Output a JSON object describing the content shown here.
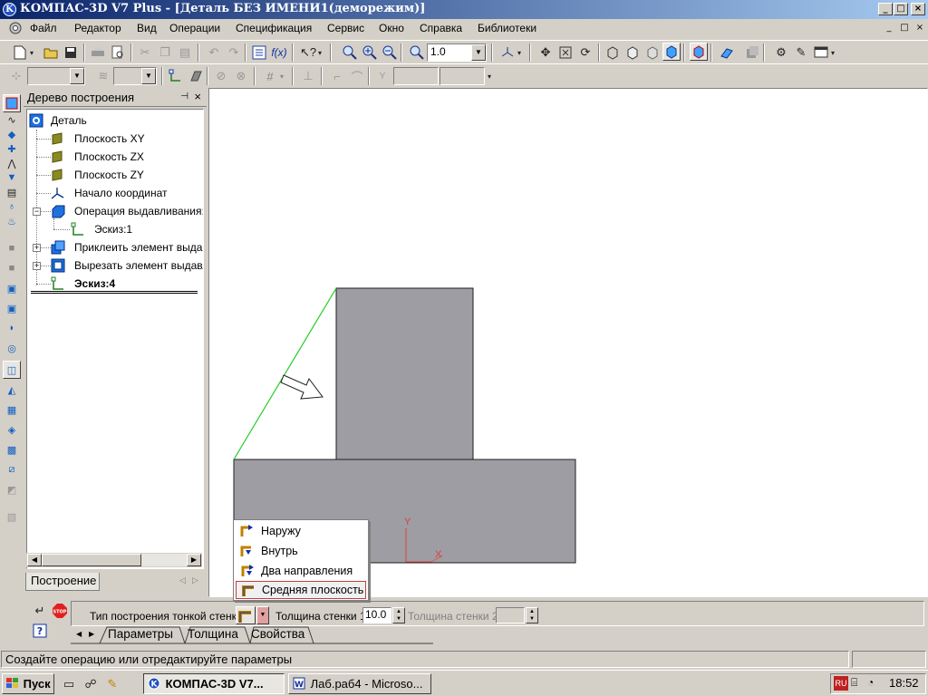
{
  "window": {
    "title": "КОМПАС-3D V7 Plus - [Деталь БЕЗ ИМЕНИ1(деморежим)]",
    "min_glyph": "_",
    "max_glyph": "□",
    "close_glyph": "×"
  },
  "menu": {
    "items": [
      "Файл",
      "Редактор",
      "Вид",
      "Операции",
      "Спецификация",
      "Сервис",
      "Окно",
      "Справка",
      "Библиотеки"
    ]
  },
  "toolbar": {
    "zoom_value": "1.0"
  },
  "tree_panel": {
    "title": "Дерево построения",
    "pin_glyph": "⊣",
    "close_glyph": "×",
    "tab_label": "Построение",
    "items": [
      {
        "label": "Деталь"
      },
      {
        "label": "Плоскость XY"
      },
      {
        "label": "Плоскость ZX"
      },
      {
        "label": "Плоскость ZY"
      },
      {
        "label": "Начало координат"
      },
      {
        "label": "Операция выдавливания:1",
        "toggle": "−"
      },
      {
        "label": "Эскиз:1"
      },
      {
        "label": "Приклеить элемент выдавливания:1",
        "toggle": "+"
      },
      {
        "label": "Вырезать элемент выдавливания:1",
        "toggle": "+"
      },
      {
        "label": "Эскиз:4"
      }
    ]
  },
  "canvas": {
    "axis_x": "X",
    "axis_y": "Y"
  },
  "dropdown": {
    "items": [
      "Наружу",
      "Внутрь",
      "Два направления",
      "Средняя плоскость"
    ],
    "selected": "Средняя плоскость"
  },
  "property_bar": {
    "wall_type_label": "Тип построения тонкой стенки",
    "thickness1_label": "Толщина стенки 1",
    "thickness1_value": "10.0",
    "thickness2_label": "Толщина стенки 2",
    "thickness2_value": "",
    "tabs": [
      "Параметры",
      "Толщина",
      "Свойства"
    ]
  },
  "status_bar": {
    "message": "Создайте операцию или отредактируйте параметры"
  },
  "taskbar": {
    "start_label": "Пуск",
    "tasks": [
      {
        "label": "КОМПАС-3D V7...",
        "active": true
      },
      {
        "label": "Лаб.раб4 - Microso...",
        "active": false
      }
    ],
    "lang": "RU",
    "clock": "18:52"
  },
  "colors": {
    "title_gradient_start": "#0a246a",
    "title_gradient_end": "#a6caf0",
    "part_fill": "#9d9da3",
    "sketch_green": "#22cc22",
    "axis_red": "#e04040",
    "selection_border": "#c04040"
  }
}
